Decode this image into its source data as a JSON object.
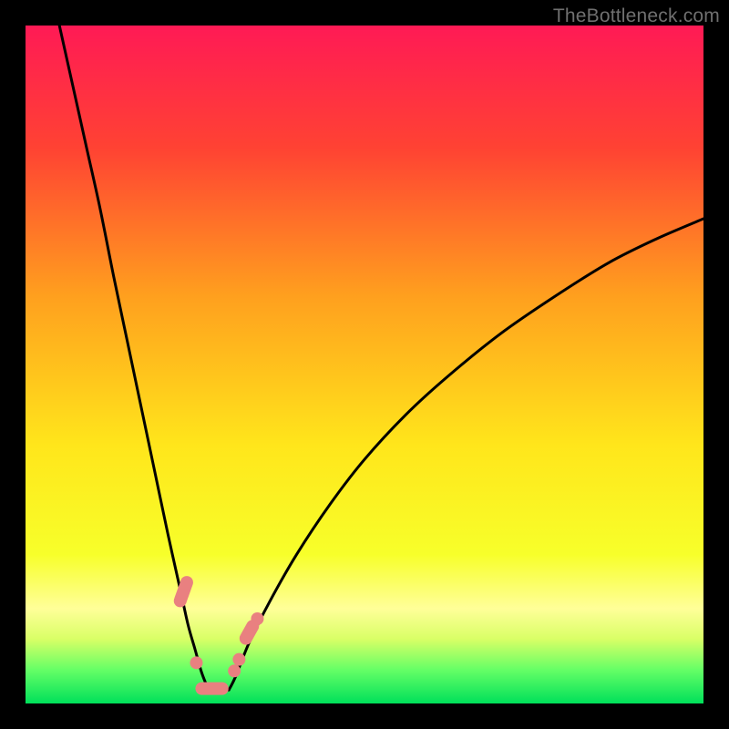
{
  "watermark": {
    "text": "TheBottleneck.com"
  },
  "chart_data": {
    "type": "line",
    "title": "",
    "xlabel": "",
    "ylabel": "",
    "xlim": [
      0,
      100
    ],
    "ylim": [
      0,
      100
    ],
    "grid": false,
    "legend": false,
    "background_gradient": {
      "stops": [
        {
          "offset": 0.0,
          "color": "#ff1a55"
        },
        {
          "offset": 0.18,
          "color": "#ff4233"
        },
        {
          "offset": 0.4,
          "color": "#ffa01e"
        },
        {
          "offset": 0.62,
          "color": "#ffe61b"
        },
        {
          "offset": 0.78,
          "color": "#f7ff2a"
        },
        {
          "offset": 0.86,
          "color": "#ffff99"
        },
        {
          "offset": 0.905,
          "color": "#d9ff66"
        },
        {
          "offset": 0.95,
          "color": "#66ff66"
        },
        {
          "offset": 1.0,
          "color": "#00e05a"
        }
      ]
    },
    "series": [
      {
        "name": "left-branch",
        "x": [
          5,
          7,
          9,
          11,
          13,
          15,
          17,
          19,
          21,
          23,
          24,
          25,
          26,
          27
        ],
        "y": [
          100,
          91,
          82,
          73,
          63,
          53.5,
          44,
          34.5,
          25,
          16,
          11.5,
          8,
          4.5,
          2
        ]
      },
      {
        "name": "right-branch",
        "x": [
          30,
          31,
          33,
          36,
          40,
          45,
          50,
          56,
          62,
          70,
          78,
          86,
          93,
          100
        ],
        "y": [
          2,
          4,
          9,
          15,
          22,
          29.5,
          36,
          42.5,
          48,
          54.5,
          60,
          65,
          68.5,
          71.5
        ]
      }
    ],
    "flat_bottom": {
      "x0": 27,
      "x1": 30,
      "y": 2
    },
    "markers": [
      {
        "type": "double-round",
        "x": 23.3,
        "y": 16.5,
        "len": 2.2
      },
      {
        "type": "dot",
        "x": 25.2,
        "y": 6.0
      },
      {
        "type": "round-seg",
        "x": 27.5,
        "y": 2.2,
        "len": 3.0,
        "horiz": true
      },
      {
        "type": "dot",
        "x": 30.8,
        "y": 4.8
      },
      {
        "type": "dot",
        "x": 31.5,
        "y": 6.5
      },
      {
        "type": "round-seg",
        "x": 33.0,
        "y": 10.5,
        "len": 2.0
      },
      {
        "type": "dot",
        "x": 34.2,
        "y": 12.5
      }
    ],
    "marker_color": "#e98080",
    "curve_color": "#000000"
  }
}
